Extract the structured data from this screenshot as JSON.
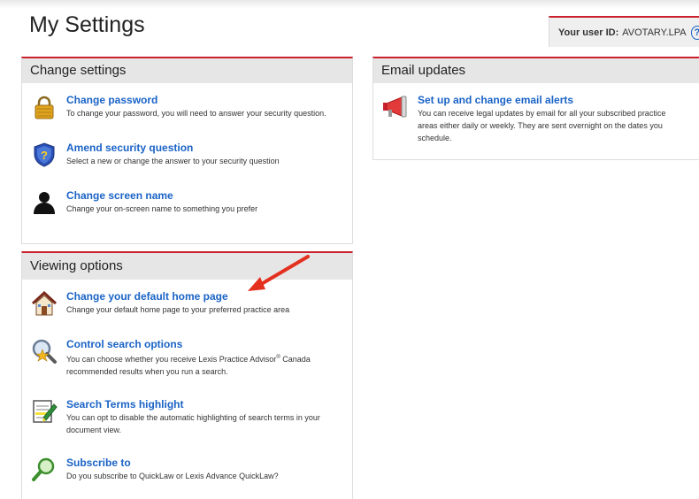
{
  "page": {
    "title": "My Settings"
  },
  "user": {
    "label": "Your user ID:",
    "id": "AVOTARY.LPA",
    "help_icon": "?"
  },
  "change_settings": {
    "header": "Change settings",
    "items": [
      {
        "icon": "padlock-icon",
        "title": "Change password",
        "desc": "To change your password, you will need to answer your security question."
      },
      {
        "icon": "shield-question-icon",
        "title": "Amend security question",
        "desc": "Select a new or change the answer to your security question"
      },
      {
        "icon": "person-silhouette-icon",
        "title": "Change screen name",
        "desc": "Change your on-screen name to something you prefer"
      }
    ]
  },
  "email_updates": {
    "header": "Email updates",
    "items": [
      {
        "icon": "megaphone-icon",
        "title": "Set up and change email alerts",
        "desc": "You can receive legal updates by email for all your subscribed practice areas either daily or weekly. They are sent overnight on the dates you schedule."
      }
    ]
  },
  "viewing_options": {
    "header": "Viewing options",
    "items": [
      {
        "icon": "house-icon",
        "title": "Change your default home page",
        "desc": "Change your default home page to your preferred practice area"
      },
      {
        "icon": "magnifier-star-icon",
        "title": "Control search options",
        "desc_pre": "You can choose whether you receive Lexis Practice Advisor",
        "desc_sup": "®",
        "desc_post": " Canada recommended results when you run a search."
      },
      {
        "icon": "highlighter-icon",
        "title": "Search Terms highlight",
        "desc": "You can opt to disable the automatic highlighting of search terms in your document view."
      },
      {
        "icon": "magnifier-green-icon",
        "title": "Subscribe to",
        "desc": "Do you subscribe to QuickLaw or Lexis Advance QuickLaw?"
      }
    ]
  },
  "colors": {
    "accent_red": "#c9202c",
    "link_blue": "#1a63c6",
    "header_gray": "#e6e6e6"
  }
}
